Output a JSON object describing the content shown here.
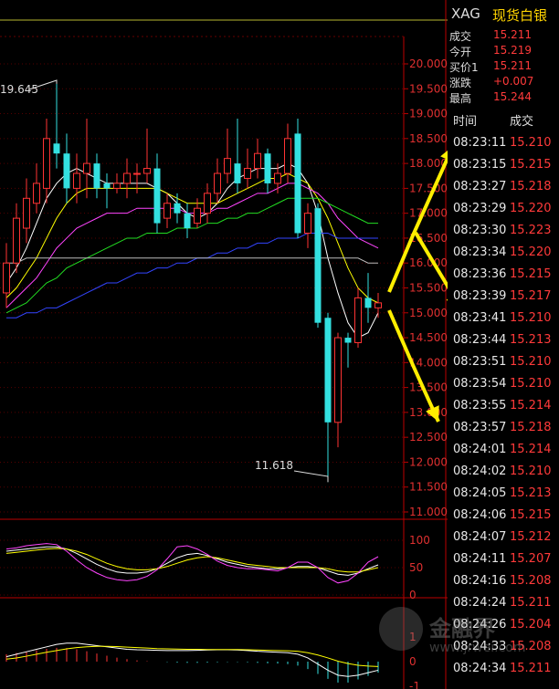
{
  "quote": {
    "symbol": "XAG",
    "name": "现货白银",
    "rows": [
      {
        "label": "成交",
        "value": "15.211",
        "color": "#ff3a3a"
      },
      {
        "label": "今开",
        "value": "15.219",
        "color": "#ff3a3a"
      },
      {
        "label": "买价1",
        "value": "15.211",
        "color": "#ff3a3a"
      },
      {
        "label": "涨跌",
        "value": "+0.007",
        "color": "#ff3a3a"
      },
      {
        "label": "最高",
        "value": "15.244",
        "color": "#ff3a3a"
      }
    ]
  },
  "ticks": {
    "header_time": "时间",
    "header_price": "成交",
    "rows": [
      {
        "time": "08:23:11",
        "price": "15.210"
      },
      {
        "time": "08:23:15",
        "price": "15.215"
      },
      {
        "time": "08:23:27",
        "price": "15.218"
      },
      {
        "time": "08:23:29",
        "price": "15.220"
      },
      {
        "time": "08:23:30",
        "price": "15.223"
      },
      {
        "time": "08:23:34",
        "price": "15.220"
      },
      {
        "time": "08:23:36",
        "price": "15.215"
      },
      {
        "time": "08:23:39",
        "price": "15.217"
      },
      {
        "time": "08:23:41",
        "price": "15.210"
      },
      {
        "time": "08:23:44",
        "price": "15.213"
      },
      {
        "time": "08:23:51",
        "price": "15.210"
      },
      {
        "time": "08:23:54",
        "price": "15.210"
      },
      {
        "time": "08:23:55",
        "price": "15.214"
      },
      {
        "time": "08:23:57",
        "price": "15.218"
      },
      {
        "time": "08:24:01",
        "price": "15.214"
      },
      {
        "time": "08:24:02",
        "price": "15.210"
      },
      {
        "time": "08:24:05",
        "price": "15.213"
      },
      {
        "time": "08:24:06",
        "price": "15.215"
      },
      {
        "time": "08:24:07",
        "price": "15.212"
      },
      {
        "time": "08:24:11",
        "price": "15.207"
      },
      {
        "time": "08:24:16",
        "price": "15.208"
      },
      {
        "time": "08:24:24",
        "price": "15.211"
      },
      {
        "time": "08:24:26",
        "price": "15.204"
      },
      {
        "time": "08:24:33",
        "price": "15.208"
      },
      {
        "time": "08:24:34",
        "price": "15.211"
      }
    ]
  },
  "chart_data": {
    "type": "candlestick",
    "price_axis": {
      "ticks": [
        "20.000",
        "19.500",
        "19.000",
        "18.500",
        "18.000",
        "17.500",
        "17.000",
        "16.500",
        "16.000",
        "15.500",
        "15.000",
        "14.500",
        "14.000",
        "13.500",
        "13.000",
        "12.500",
        "12.000",
        "11.500",
        "11.000"
      ],
      "min": 11.0,
      "max": 20.0
    },
    "annotations": {
      "high_label": "19.645",
      "low_label": "11.618"
    },
    "candles": [
      {
        "o": 15.4,
        "c": 16.0,
        "h": 16.4,
        "l": 15.1
      },
      {
        "o": 16.0,
        "c": 16.9,
        "h": 17.2,
        "l": 15.8
      },
      {
        "o": 16.7,
        "c": 17.3,
        "h": 17.7,
        "l": 16.4
      },
      {
        "o": 17.2,
        "c": 17.6,
        "h": 18.0,
        "l": 17.0
      },
      {
        "o": 17.5,
        "c": 18.5,
        "h": 18.9,
        "l": 17.2
      },
      {
        "o": 18.4,
        "c": 18.2,
        "h": 19.6,
        "l": 17.9
      },
      {
        "o": 18.2,
        "c": 17.5,
        "h": 18.6,
        "l": 17.2
      },
      {
        "o": 17.5,
        "c": 17.8,
        "h": 18.2,
        "l": 17.2
      },
      {
        "o": 17.8,
        "c": 18.0,
        "h": 18.9,
        "l": 17.3
      },
      {
        "o": 18.0,
        "c": 17.5,
        "h": 18.2,
        "l": 17.3
      },
      {
        "o": 17.6,
        "c": 17.5,
        "h": 17.8,
        "l": 17.1
      },
      {
        "o": 17.5,
        "c": 17.6,
        "h": 17.8,
        "l": 17.4
      },
      {
        "o": 17.6,
        "c": 17.8,
        "h": 18.1,
        "l": 17.3
      },
      {
        "o": 17.8,
        "c": 17.8,
        "h": 18.0,
        "l": 17.4
      },
      {
        "o": 17.8,
        "c": 17.9,
        "h": 18.7,
        "l": 17.6
      },
      {
        "o": 17.9,
        "c": 16.8,
        "h": 18.2,
        "l": 16.6
      },
      {
        "o": 16.9,
        "c": 17.2,
        "h": 17.4,
        "l": 16.7
      },
      {
        "o": 17.2,
        "c": 17.0,
        "h": 17.4,
        "l": 16.8
      },
      {
        "o": 17.0,
        "c": 16.7,
        "h": 17.2,
        "l": 16.5
      },
      {
        "o": 16.8,
        "c": 17.1,
        "h": 17.3,
        "l": 16.7
      },
      {
        "o": 17.0,
        "c": 17.4,
        "h": 17.6,
        "l": 16.8
      },
      {
        "o": 17.4,
        "c": 17.8,
        "h": 18.1,
        "l": 17.2
      },
      {
        "o": 17.8,
        "c": 18.1,
        "h": 18.7,
        "l": 17.6
      },
      {
        "o": 18.0,
        "c": 17.6,
        "h": 18.9,
        "l": 17.4
      },
      {
        "o": 17.7,
        "c": 17.9,
        "h": 18.3,
        "l": 17.5
      },
      {
        "o": 17.9,
        "c": 18.2,
        "h": 18.5,
        "l": 17.7
      },
      {
        "o": 18.2,
        "c": 17.6,
        "h": 18.3,
        "l": 17.4
      },
      {
        "o": 17.6,
        "c": 17.8,
        "h": 18.0,
        "l": 17.4
      },
      {
        "o": 17.8,
        "c": 18.5,
        "h": 18.8,
        "l": 17.6
      },
      {
        "o": 18.6,
        "c": 16.6,
        "h": 18.9,
        "l": 16.5
      },
      {
        "o": 16.6,
        "c": 17.0,
        "h": 17.2,
        "l": 16.3
      },
      {
        "o": 17.1,
        "c": 14.8,
        "h": 17.2,
        "l": 14.7
      },
      {
        "o": 14.9,
        "c": 12.8,
        "h": 15.0,
        "l": 11.6
      },
      {
        "o": 12.8,
        "c": 14.5,
        "h": 14.6,
        "l": 12.3
      },
      {
        "o": 14.5,
        "c": 14.4,
        "h": 14.6,
        "l": 13.9
      },
      {
        "o": 14.4,
        "c": 15.3,
        "h": 15.5,
        "l": 14.3
      },
      {
        "o": 15.3,
        "c": 15.1,
        "h": 15.8,
        "l": 14.8
      },
      {
        "o": 15.1,
        "c": 15.2,
        "h": 15.4,
        "l": 14.9
      }
    ],
    "ma_lines": [
      {
        "color": "#ffffff",
        "values": [
          15.6,
          15.9,
          16.3,
          16.8,
          17.3,
          17.6,
          17.8,
          17.9,
          17.8,
          17.7,
          17.6,
          17.6,
          17.6,
          17.6,
          17.6,
          17.5,
          17.4,
          17.2,
          17.0,
          16.9,
          17.0,
          17.2,
          17.5,
          17.7,
          17.8,
          17.9,
          17.9,
          17.9,
          18.0,
          17.9,
          17.6,
          17.0,
          16.1,
          15.4,
          14.8,
          14.5,
          14.6,
          15.0
        ]
      },
      {
        "color": "#ffff00",
        "values": [
          15.3,
          15.5,
          15.8,
          16.1,
          16.5,
          16.9,
          17.2,
          17.4,
          17.5,
          17.5,
          17.5,
          17.5,
          17.5,
          17.5,
          17.5,
          17.5,
          17.4,
          17.3,
          17.2,
          17.2,
          17.2,
          17.2,
          17.3,
          17.4,
          17.5,
          17.6,
          17.7,
          17.7,
          17.8,
          17.7,
          17.6,
          17.3,
          16.9,
          16.4,
          15.9,
          15.5,
          15.3,
          15.2
        ]
      },
      {
        "color": "#ff44ff",
        "values": [
          15.1,
          15.3,
          15.5,
          15.7,
          16.0,
          16.3,
          16.5,
          16.7,
          16.8,
          16.9,
          17.0,
          17.0,
          17.0,
          17.1,
          17.1,
          17.1,
          17.1,
          17.1,
          17.0,
          17.0,
          17.0,
          17.1,
          17.1,
          17.2,
          17.3,
          17.4,
          17.4,
          17.5,
          17.6,
          17.6,
          17.5,
          17.4,
          17.2,
          16.9,
          16.7,
          16.5,
          16.4,
          16.3
        ]
      },
      {
        "color": "#22dd22",
        "values": [
          15.0,
          15.1,
          15.2,
          15.4,
          15.6,
          15.7,
          15.9,
          16.0,
          16.1,
          16.2,
          16.3,
          16.4,
          16.5,
          16.5,
          16.6,
          16.6,
          16.6,
          16.7,
          16.7,
          16.7,
          16.8,
          16.8,
          16.9,
          16.9,
          17.0,
          17.0,
          17.1,
          17.2,
          17.3,
          17.3,
          17.3,
          17.3,
          17.2,
          17.1,
          17.0,
          16.9,
          16.8,
          16.8
        ]
      },
      {
        "color": "#3344ff",
        "values": [
          14.9,
          14.9,
          15.0,
          15.0,
          15.1,
          15.1,
          15.2,
          15.3,
          15.4,
          15.5,
          15.6,
          15.6,
          15.7,
          15.8,
          15.8,
          15.9,
          15.9,
          16.0,
          16.0,
          16.1,
          16.1,
          16.2,
          16.2,
          16.3,
          16.3,
          16.4,
          16.4,
          16.5,
          16.5,
          16.5,
          16.6,
          16.6,
          16.6,
          16.5,
          16.5,
          16.5,
          16.5,
          16.5
        ]
      },
      {
        "color": "#bbbbbb",
        "values": [
          16.0,
          16.0,
          16.1,
          16.1,
          16.1,
          16.1,
          16.1,
          16.1,
          16.1,
          16.1,
          16.1,
          16.1,
          16.1,
          16.1,
          16.1,
          16.1,
          16.1,
          16.1,
          16.1,
          16.1,
          16.1,
          16.1,
          16.1,
          16.1,
          16.1,
          16.1,
          16.1,
          16.1,
          16.1,
          16.1,
          16.1,
          16.1,
          16.1,
          16.1,
          16.1,
          16.1,
          16.0,
          16.0
        ]
      }
    ],
    "oscillator": {
      "ticks": [
        "100",
        "50",
        "0"
      ],
      "min": 0,
      "max": 100,
      "lines": [
        {
          "color": "#ffffff",
          "values": [
            80,
            82,
            84,
            86,
            88,
            88,
            84,
            76,
            66,
            56,
            48,
            42,
            40,
            40,
            42,
            48,
            58,
            68,
            74,
            76,
            72,
            66,
            60,
            56,
            52,
            50,
            48,
            48,
            50,
            52,
            52,
            50,
            44,
            38,
            36,
            40,
            48,
            55
          ]
        },
        {
          "color": "#ffff00",
          "values": [
            76,
            78,
            80,
            82,
            84,
            85,
            84,
            80,
            74,
            66,
            58,
            52,
            48,
            46,
            46,
            48,
            52,
            58,
            64,
            68,
            70,
            68,
            64,
            60,
            56,
            54,
            52,
            50,
            50,
            50,
            50,
            50,
            48,
            44,
            42,
            42,
            46,
            50
          ]
        },
        {
          "color": "#ff44ff",
          "values": [
            84,
            86,
            90,
            92,
            94,
            92,
            80,
            64,
            50,
            40,
            32,
            28,
            26,
            28,
            34,
            46,
            66,
            88,
            90,
            84,
            74,
            62,
            54,
            50,
            48,
            48,
            46,
            44,
            50,
            60,
            60,
            50,
            32,
            22,
            26,
            40,
            60,
            70
          ]
        }
      ]
    },
    "macd": {
      "ticks": [
        "1",
        "0",
        "-1"
      ],
      "min": -1,
      "max": 1,
      "bars": [
        0.3,
        0.35,
        0.4,
        0.46,
        0.52,
        0.56,
        0.55,
        0.5,
        0.42,
        0.33,
        0.24,
        0.16,
        0.1,
        0.05,
        0.02,
        0.0,
        -0.02,
        -0.04,
        -0.05,
        -0.05,
        -0.04,
        -0.03,
        -0.02,
        -0.02,
        -0.03,
        -0.05,
        -0.07,
        -0.08,
        -0.1,
        -0.16,
        -0.3,
        -0.5,
        -0.7,
        -0.85,
        -0.85,
        -0.72,
        -0.58,
        -0.45
      ],
      "lines": [
        {
          "color": "#ffffff",
          "values": [
            0.2,
            0.3,
            0.4,
            0.5,
            0.6,
            0.7,
            0.75,
            0.75,
            0.7,
            0.65,
            0.6,
            0.55,
            0.5,
            0.48,
            0.47,
            0.46,
            0.45,
            0.45,
            0.45,
            0.46,
            0.47,
            0.48,
            0.48,
            0.47,
            0.45,
            0.42,
            0.4,
            0.38,
            0.36,
            0.3,
            0.15,
            -0.1,
            -0.35,
            -0.55,
            -0.6,
            -0.55,
            -0.45,
            -0.35
          ]
        },
        {
          "color": "#ffff00",
          "values": [
            0.1,
            0.15,
            0.22,
            0.3,
            0.38,
            0.45,
            0.52,
            0.57,
            0.6,
            0.62,
            0.62,
            0.61,
            0.59,
            0.57,
            0.55,
            0.53,
            0.52,
            0.51,
            0.5,
            0.5,
            0.49,
            0.49,
            0.49,
            0.49,
            0.48,
            0.47,
            0.46,
            0.45,
            0.44,
            0.42,
            0.36,
            0.27,
            0.15,
            0.02,
            -0.08,
            -0.15,
            -0.18,
            -0.2
          ]
        }
      ]
    }
  },
  "watermark": {
    "brand": "金融界",
    "url": "www.jrwei.com"
  }
}
